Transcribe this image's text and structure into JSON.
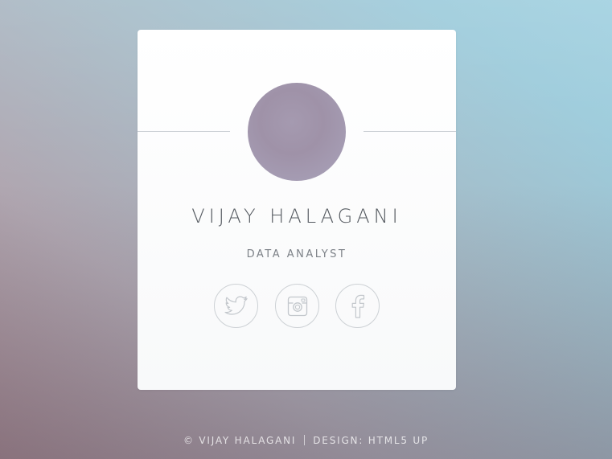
{
  "profile": {
    "name": "VIJAY HALAGANI",
    "title": "DATA ANALYST"
  },
  "social": [
    {
      "icon": "twitter-icon"
    },
    {
      "icon": "instagram-icon"
    },
    {
      "icon": "facebook-icon"
    }
  ],
  "footer": {
    "copyright": "© VIJAY HALAGANI",
    "design": "DESIGN: HTML5 UP"
  },
  "colors": {
    "card": "#ffffff",
    "divider": "#c9ced3",
    "icon_stroke": "#c3c7cc",
    "name_text": "#555a60",
    "title_text": "#7d8288",
    "avatar": "#a59ab0"
  }
}
